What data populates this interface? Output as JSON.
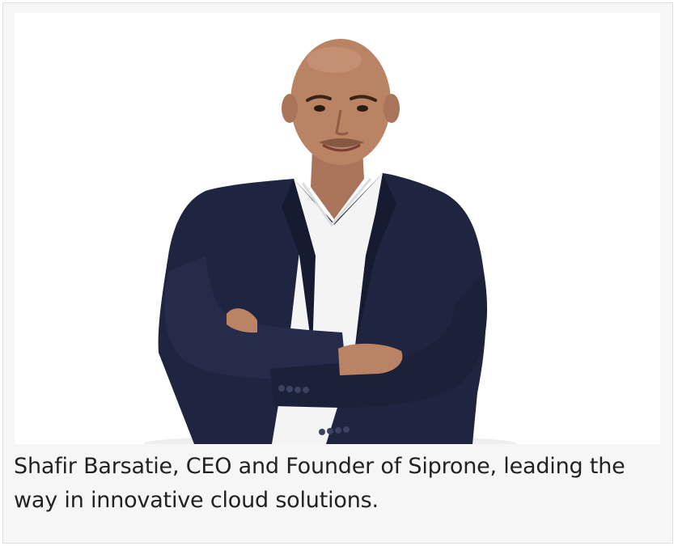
{
  "figure": {
    "caption": "Shafir Barsatie, CEO and Founder of Siprone, leading the way in innovative cloud solutions."
  },
  "colors": {
    "frame_border": "#dedede",
    "frame_background": "#f6f6f6",
    "photo_background": "#ffffff",
    "caption_text": "#222222",
    "jacket": "#1f2540",
    "shirt": "#f4f4f4",
    "skin": "#b98364"
  }
}
